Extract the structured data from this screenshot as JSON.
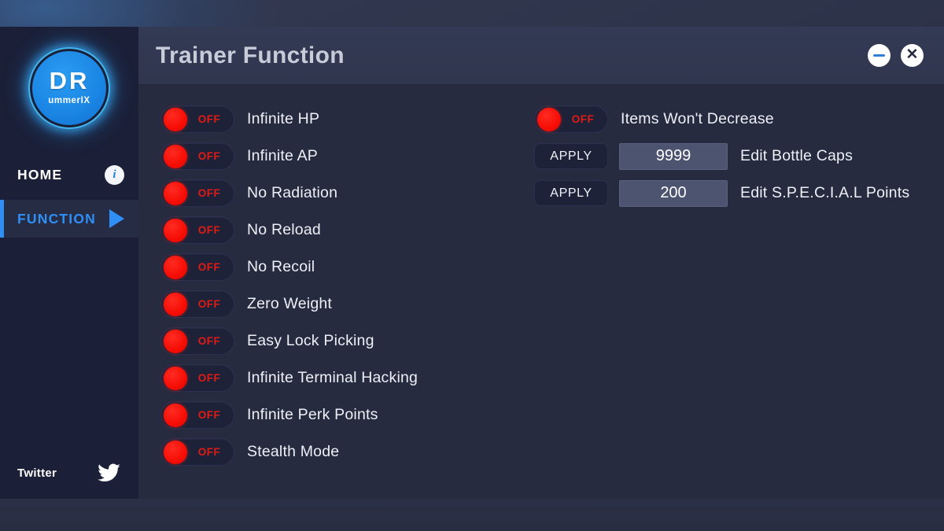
{
  "window": {
    "title": "Trainer Function",
    "minimize_label": "minimize",
    "close_label": "close"
  },
  "sidebar": {
    "logo": {
      "primary": "DR",
      "secondary": "ummerIX"
    },
    "items": [
      {
        "label": "HOME",
        "icon": "info-icon",
        "active": false
      },
      {
        "label": "FUNCTION",
        "icon": "play-icon",
        "active": true
      }
    ],
    "footer": {
      "label": "Twitter",
      "icon": "twitter-bird-icon"
    }
  },
  "colors": {
    "accent_blue": "#2f8ff5",
    "toggle_red": "#e01b14",
    "sidebar_bg": "#1b2038",
    "main_bg": "#262b40",
    "titlebar_bg": "#30364e",
    "field_bg": "#4d5470"
  },
  "main": {
    "left_column": [
      {
        "type": "toggle",
        "state": "OFF",
        "label": "Infinite HP"
      },
      {
        "type": "toggle",
        "state": "OFF",
        "label": "Infinite AP"
      },
      {
        "type": "toggle",
        "state": "OFF",
        "label": "No Radiation"
      },
      {
        "type": "toggle",
        "state": "OFF",
        "label": "No Reload"
      },
      {
        "type": "toggle",
        "state": "OFF",
        "label": "No Recoil"
      },
      {
        "type": "toggle",
        "state": "OFF",
        "label": "Zero Weight"
      },
      {
        "type": "toggle",
        "state": "OFF",
        "label": "Easy Lock Picking"
      },
      {
        "type": "toggle",
        "state": "OFF",
        "label": "Infinite Terminal Hacking"
      },
      {
        "type": "toggle",
        "state": "OFF",
        "label": "Infinite Perk Points"
      },
      {
        "type": "toggle",
        "state": "OFF",
        "label": "Stealth Mode"
      }
    ],
    "right_column": [
      {
        "type": "toggle",
        "state": "OFF",
        "label": "Items Won't Decrease"
      },
      {
        "type": "apply",
        "button": "APPLY",
        "value": "9999",
        "label": "Edit Bottle Caps"
      },
      {
        "type": "apply",
        "button": "APPLY",
        "value": "200",
        "label": "Edit S.P.E.C.I.A.L Points"
      }
    ]
  }
}
